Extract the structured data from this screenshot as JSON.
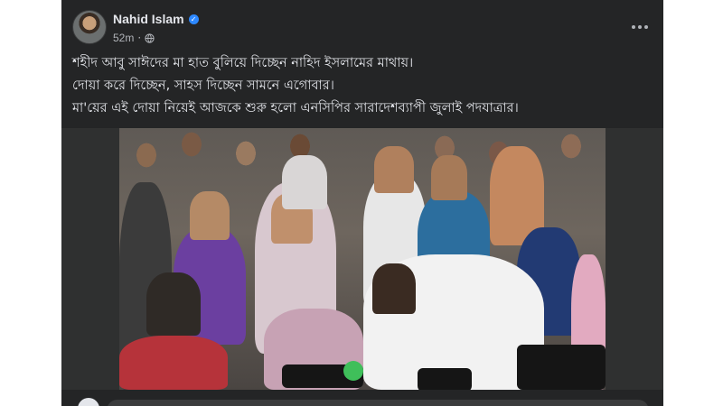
{
  "post": {
    "author": "Nahid Islam",
    "verified_icon": "verified-badge-icon",
    "timestamp": "52m",
    "separator": "·",
    "privacy_icon": "globe-icon",
    "more_icon": "more-horizontal-icon",
    "text_lines": [
      "শহীদ আবু সাঈদের মা হাত বুলিয়ে দিচ্ছেন নাহিদ ইসলামের মাথায়।",
      "দোয়া করে দিচ্ছেন, সাহস দিচ্ছেন সামনে এগোবার।",
      "মা'য়ের এই দোয়া নিয়েই আজকে শুরু হলো এনসিপির সারাদেশব্যাপী জুলাই পদযাত্রার।"
    ]
  },
  "colors": {
    "card_background": "#242526",
    "primary_text": "#e4e6eb",
    "secondary_text": "#b0b3b8",
    "verified_blue": "#2d88ff"
  }
}
